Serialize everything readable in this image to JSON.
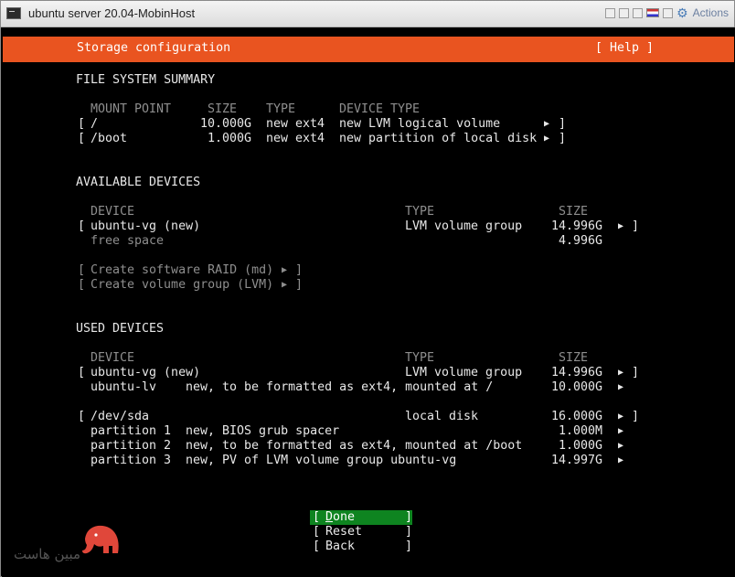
{
  "window": {
    "title": "ubuntu server 20.04-MobinHost",
    "actions_label": "Actions"
  },
  "header": {
    "title": "Storage configuration",
    "help": "[ Help ]"
  },
  "fs_summary": {
    "heading": "FILE SYSTEM SUMMARY",
    "columns": [
      "MOUNT POINT",
      "SIZE",
      "TYPE",
      "DEVICE TYPE"
    ],
    "rows": [
      {
        "mount": "/",
        "size": "10.000G",
        "type": "new ext4",
        "device_type": "new LVM logical volume"
      },
      {
        "mount": "/boot",
        "size": "1.000G",
        "type": "new ext4",
        "device_type": "new partition of local disk"
      }
    ]
  },
  "available": {
    "heading": "AVAILABLE DEVICES",
    "columns": [
      "DEVICE",
      "TYPE",
      "SIZE"
    ],
    "device": {
      "name": "ubuntu-vg (new)",
      "type": "LVM volume group",
      "size": "14.996G"
    },
    "free_space": {
      "label": "free space",
      "size": "4.996G"
    },
    "actions": [
      "Create software RAID (md)",
      "Create volume group (LVM)"
    ]
  },
  "used": {
    "heading": "USED DEVICES",
    "columns": [
      "DEVICE",
      "TYPE",
      "SIZE"
    ],
    "vg": {
      "name": "ubuntu-vg (new)",
      "type": "LVM volume group",
      "size": "14.996G"
    },
    "lv": {
      "name": "ubuntu-lv",
      "desc": "new, to be formatted as ext4, mounted at /",
      "size": "10.000G"
    },
    "disk": {
      "name": "/dev/sda",
      "type": "local disk",
      "size": "16.000G"
    },
    "partitions": [
      {
        "name": "partition 1",
        "desc": "new, BIOS grub spacer",
        "size": "1.000M"
      },
      {
        "name": "partition 2",
        "desc": "new, to be formatted as ext4, mounted at /boot",
        "size": "1.000G"
      },
      {
        "name": "partition 3",
        "desc": "new, PV of LVM volume group ubuntu-vg",
        "size": "14.997G"
      }
    ]
  },
  "buttons": {
    "done_first": "D",
    "done_rest": "one",
    "reset": "Reset",
    "back": "Back"
  },
  "logo": {
    "text": "مبین هاست"
  },
  "colors": {
    "accent": "#e95420",
    "selected": "#0e8420"
  }
}
